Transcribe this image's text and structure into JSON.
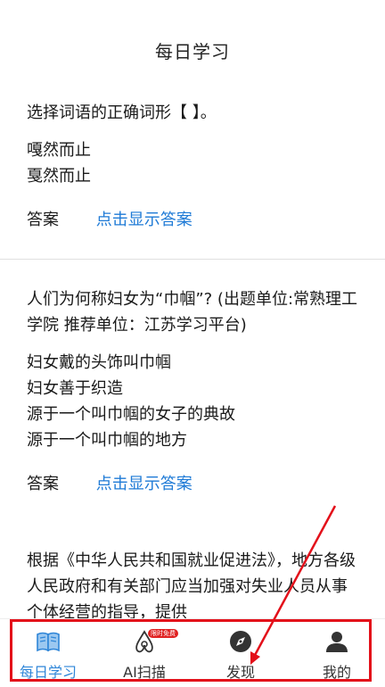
{
  "header": {
    "title": "每日学习"
  },
  "questions": [
    {
      "text": "选择词语的正确词形【 】。",
      "options": [
        "嘎然而止",
        "戛然而止"
      ],
      "answer_label": "答案",
      "answer_link": "点击显示答案"
    },
    {
      "text": "人们为何称妇女为“巾帼”? (出题单位:常熟理工学院 推荐单位：江苏学习平台)",
      "options": [
        "妇女戴的头饰叫巾帼",
        "妇女善于织造",
        "源于一个叫巾帼的女子的典故",
        "源于一个叫巾帼的地方"
      ],
      "answer_label": "答案",
      "answer_link": "点击显示答案"
    },
    {
      "text": "根据《中华人民共和国就业促进法》，地方各级人民政府和有关部门应当加强对失业人员从事个体经营的指导，提供"
    }
  ],
  "tabbar": {
    "tabs": [
      {
        "label": "每日学习",
        "icon": "book-icon",
        "active": true
      },
      {
        "label": "AI扫描",
        "icon": "ai-scan-icon",
        "badge": "限时免费"
      },
      {
        "label": "发现",
        "icon": "compass-icon"
      },
      {
        "label": "我的",
        "icon": "user-icon"
      }
    ]
  },
  "colors": {
    "accent": "#2f86d8",
    "link": "#1e7ad6",
    "annotation": "#e3101a"
  }
}
